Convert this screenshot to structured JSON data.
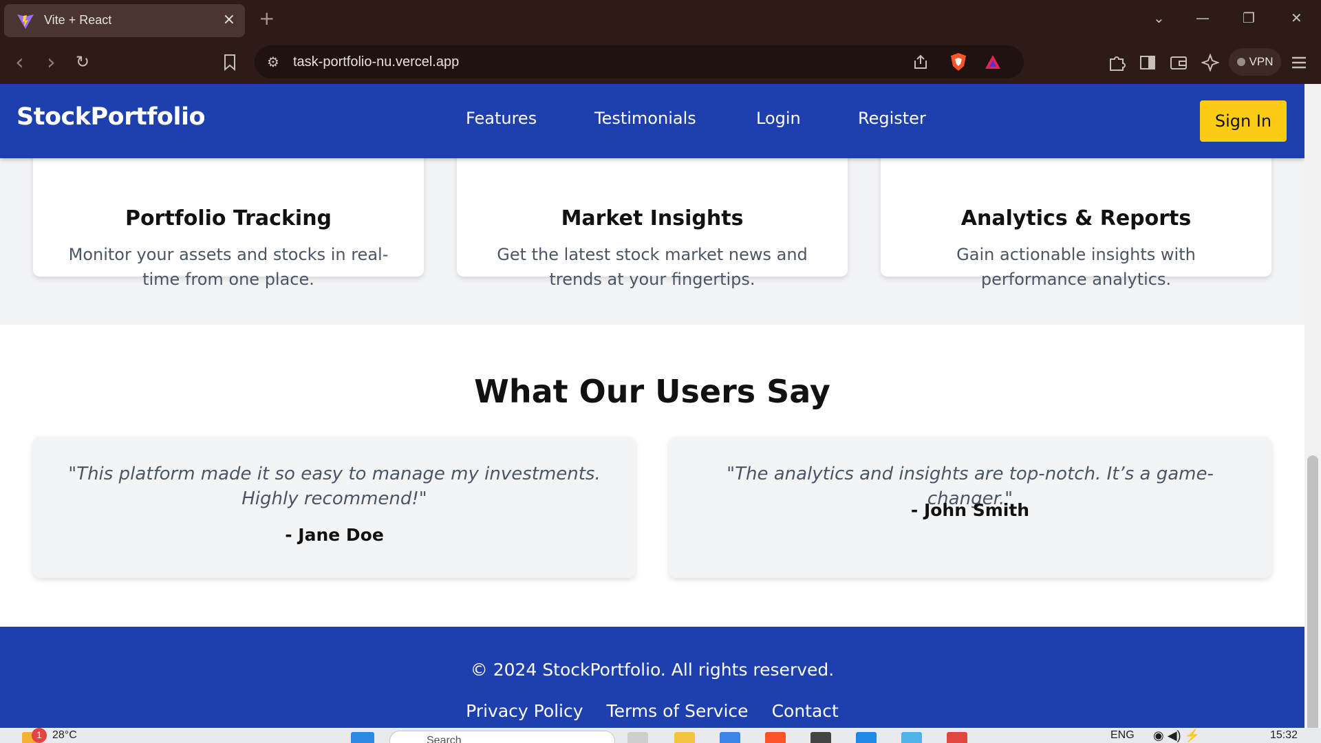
{
  "browser": {
    "tab_title": "Vite + React",
    "tab_close": "×",
    "new_tab": "+",
    "url": "task-portfolio-nu.vercel.app",
    "vpn_label": "VPN",
    "controls": {
      "back": "‹",
      "forward": "›",
      "reload": "↻",
      "tabs_menu": "⌄",
      "minimize": "—",
      "restore": "❐",
      "close": "✕"
    }
  },
  "nav": {
    "brand": "StockPortfolio",
    "links": [
      "Features",
      "Testimonials",
      "Login",
      "Register"
    ],
    "signin": "Sign In"
  },
  "features": [
    {
      "title": "Portfolio Tracking",
      "desc": "Monitor your assets and stocks in real-time from one place."
    },
    {
      "title": "Market Insights",
      "desc": "Get the latest stock market news and trends at your fingertips."
    },
    {
      "title": "Analytics & Reports",
      "desc": "Gain actionable insights with performance analytics."
    }
  ],
  "testimonials": {
    "title": "What Our Users Say",
    "items": [
      {
        "quote": "\"This platform made it so easy to manage my investments. Highly recommend!\"",
        "author": "- Jane Doe"
      },
      {
        "quote": "\"The analytics and insights are top-notch. It’s a game-changer.\"",
        "author": "- John Smith"
      }
    ]
  },
  "footer": {
    "copyright": "© 2024 StockPortfolio. All rights reserved.",
    "links": [
      "Privacy Policy",
      "Terms of Service",
      "Contact"
    ]
  },
  "taskbar": {
    "weather": "28°C",
    "notification_count": "1",
    "search_placeholder": "Search",
    "language": "ENG",
    "time": "15:32"
  },
  "colors": {
    "nav_bg": "#1e40af",
    "accent": "#facc15",
    "chrome_bg": "#2d1b17"
  }
}
